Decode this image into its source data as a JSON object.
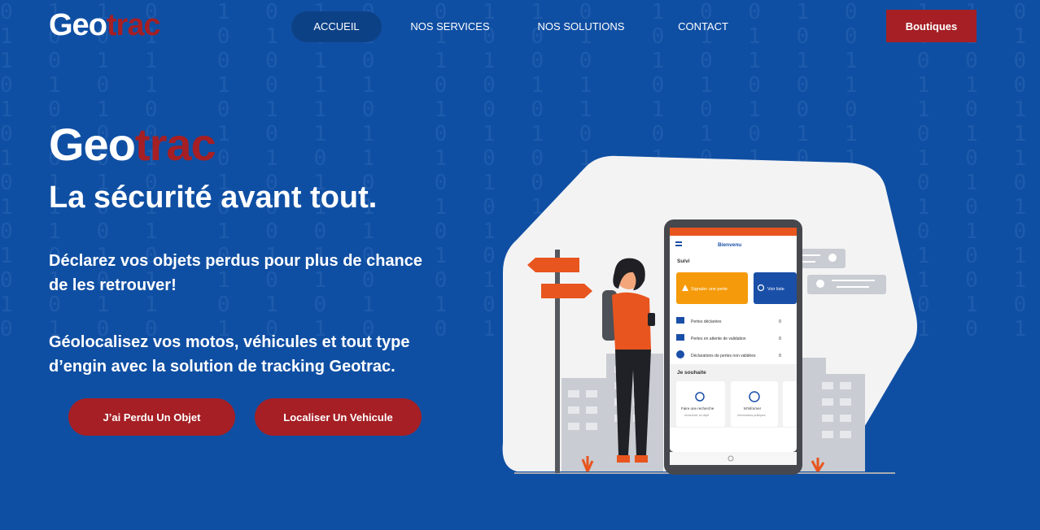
{
  "header": {
    "logo_part1": "Geo",
    "logo_part2": "trac",
    "nav": [
      "ACCUEIL",
      "NOS SERVICES",
      "NOS SOLUTIONS",
      "CONTACT"
    ],
    "cta": "Boutiques"
  },
  "hero": {
    "brand_part1": "Geo",
    "brand_part2": "trac",
    "title": "La sécurité avant tout.",
    "paragraph1": "Déclarez vos objets perdus pour plus de chance de les retrouver!",
    "paragraph2": "Géolocalisez vos motos, véhicules et tout type d’engin avec la solution de tracking Geotrac.",
    "button_lost": "J’ai Perdu Un Objet",
    "button_locate": "Localiser Un Vehicule"
  },
  "phone_app": {
    "header_title": "Bienvenu",
    "section_suivi": "Suivi",
    "tile_report": "Signaler une perte",
    "tile_list": "Voir liste",
    "rows": [
      {
        "label": "Pertes déclarées",
        "count": "0"
      },
      {
        "label": "Pertes en attente de validation",
        "count": "0"
      },
      {
        "label": "Déclarations de pertes non validées",
        "count": "0"
      }
    ],
    "section_wish": "Je souhaite",
    "card_search_title": "Faire une recherche",
    "card_search_sub": "rechercher un objet",
    "card_info_title": "M'informer",
    "card_info_sub": "Informations pratiques"
  },
  "colors": {
    "background": "#0f4fa3",
    "accent": "#a51f24",
    "app_orange": "#f59a0a",
    "app_blue": "#1a4fa8"
  }
}
